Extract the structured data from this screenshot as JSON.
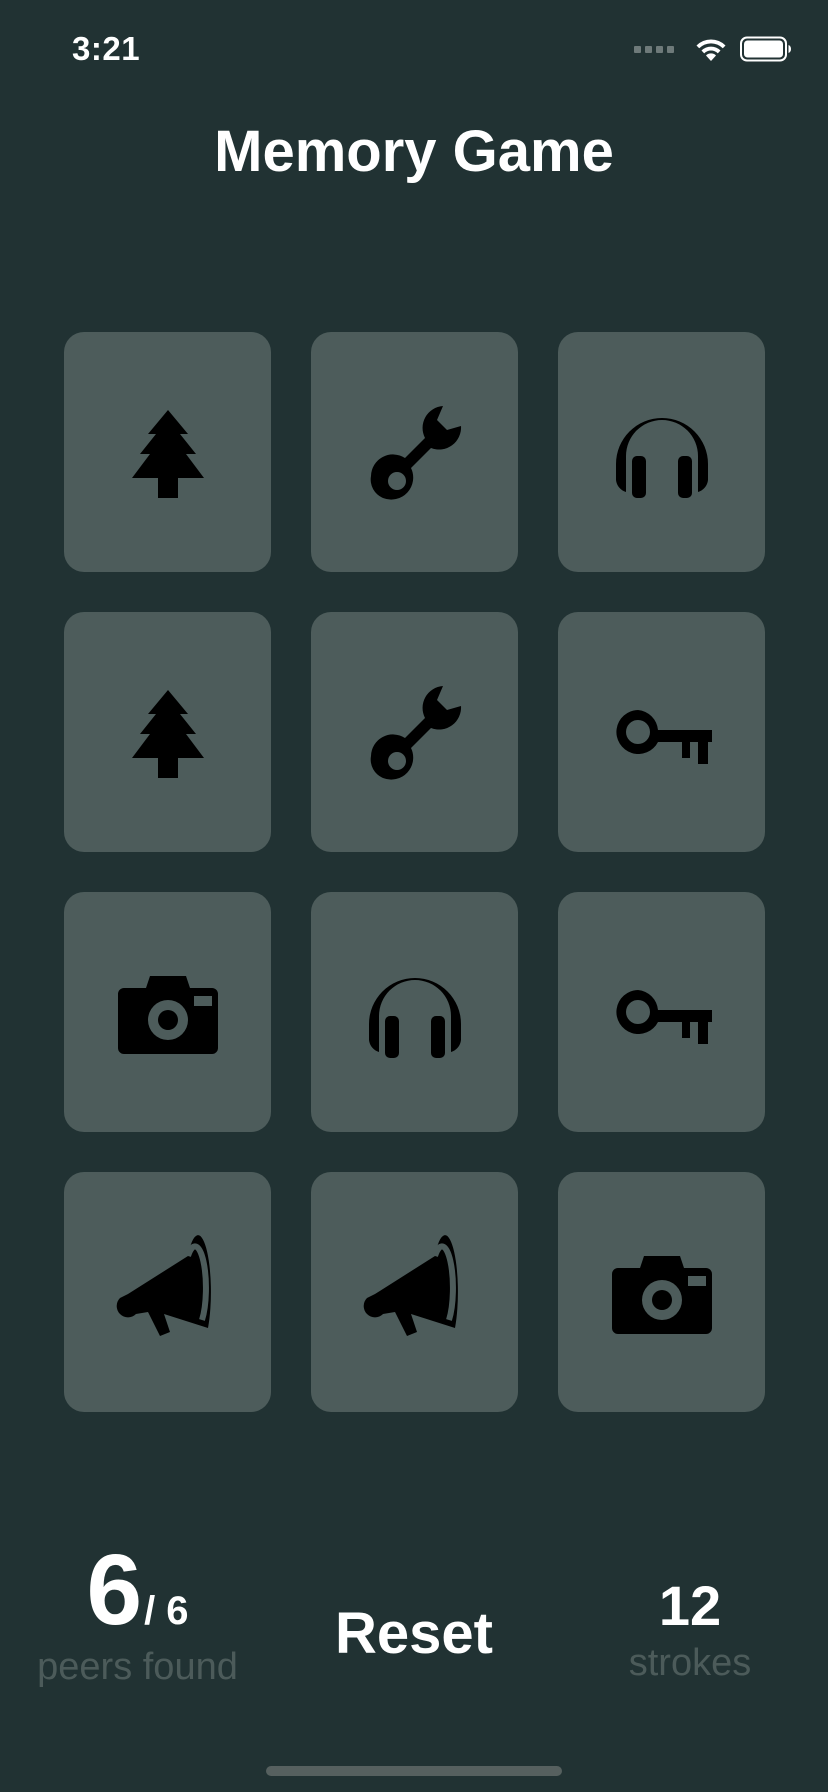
{
  "status_bar": {
    "time": "3:21",
    "signal_icon": "cellular-signal-icon",
    "wifi_icon": "wifi-icon",
    "battery_icon": "battery-icon"
  },
  "title": "Memory Game",
  "cards": [
    {
      "icon": "tree"
    },
    {
      "icon": "wrench"
    },
    {
      "icon": "headphones"
    },
    {
      "icon": "tree"
    },
    {
      "icon": "wrench"
    },
    {
      "icon": "key"
    },
    {
      "icon": "camera"
    },
    {
      "icon": "headphones"
    },
    {
      "icon": "key"
    },
    {
      "icon": "megaphone"
    },
    {
      "icon": "megaphone"
    },
    {
      "icon": "camera"
    }
  ],
  "score": {
    "found": "6",
    "total": "/ 6",
    "label": "peers found"
  },
  "reset_label": "Reset",
  "strokes": {
    "count": "12",
    "label": "strokes"
  },
  "colors": {
    "background": "#213233",
    "card": "#4d5c5b",
    "icon": "#000000",
    "muted_text": "#4c5b5a"
  }
}
